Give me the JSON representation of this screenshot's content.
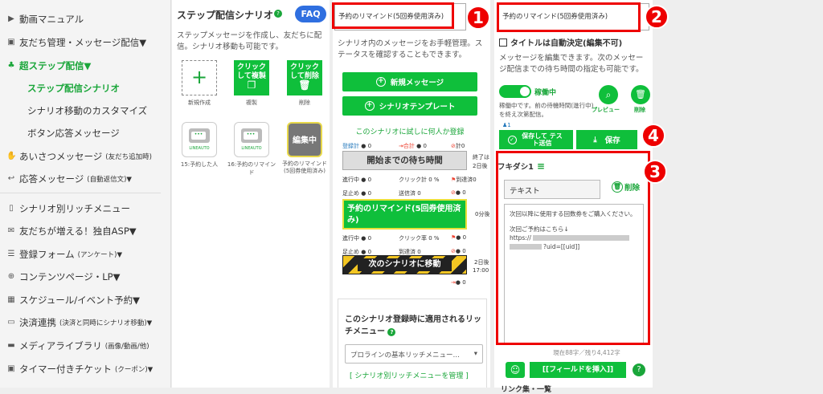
{
  "sidebar": {
    "items": [
      {
        "label": "動画マニュアル",
        "icon": "video-icon"
      },
      {
        "label": "友だち管理・メッセージ配信▼",
        "icon": "contact-icon"
      },
      {
        "label": "超ステップ配信▼",
        "icon": "hierarchy-icon"
      },
      {
        "label": "ステップ配信シナリオ"
      },
      {
        "label": "シナリオ移動のカスタマイズ"
      },
      {
        "label": "ボタン応答メッセージ"
      },
      {
        "label": "あいさつメッセージ",
        "small": "(友だち追加時)",
        "icon": "hand-icon"
      },
      {
        "label": "応答メッセージ",
        "small": "(自動返信文)▼",
        "icon": "reply-icon"
      },
      {
        "label": "シナリオ別リッチメニュー",
        "icon": "phone-icon"
      },
      {
        "label": "友だちが増える！独自ASP▼",
        "icon": "gift-icon"
      },
      {
        "label": "登録フォーム",
        "small": "(アンケート)▼",
        "icon": "list-icon"
      },
      {
        "label": "コンテンツページ・LP▼",
        "icon": "globe-icon"
      },
      {
        "label": "スケジュール/イベント予約▼",
        "icon": "calendar-icon"
      },
      {
        "label": "決済連携",
        "small": "(決済と同時にシナリオ移動)▼",
        "icon": "card-icon"
      },
      {
        "label": "メディアライブラリ",
        "small": "(画像/動画/他)",
        "icon": "folder-icon"
      },
      {
        "label": "タイマー付きチケット",
        "small": "(クーポン)▼",
        "icon": "ticket-icon"
      }
    ]
  },
  "scenario": {
    "title": "ステップ配信シナリオ",
    "faq": "FAQ",
    "desc": "ステップメッセージを作成し、友だちに配信。シナリオ移動も可能です。",
    "new_label": "新規作成",
    "copy_btn": "クリックして複製",
    "copy_label": "複製",
    "delete_btn": "クリックして削除",
    "delete_label": "削除",
    "cards": [
      {
        "label": "15:予約した人",
        "logo": "LINEAUTO"
      },
      {
        "label": "16:予約のリマインド",
        "logo": "LINEAUTO"
      },
      {
        "label": "予約のリマインド(5回券使用済み)",
        "overlay": "編集中"
      }
    ]
  },
  "middle": {
    "name_value": "予約のリマインド(5回券使用済み)",
    "desc": "シナリオ内のメッセージをお手軽管理。ステータスを確認することもできます。",
    "new_msg": "新規メッセージ",
    "template": "シナリオテンプレート",
    "test_link": "このシナリオに試しに何人か登録",
    "stats_top": {
      "reg": "登録計",
      "reg_v": "0",
      "total": "合計",
      "total_v": "0",
      "block": "計",
      "block_v": "0"
    },
    "start_label": "開始までの待ち時間",
    "end_label": "終了は",
    "end_days": "2日後",
    "row1": {
      "a": "進行中",
      "a_v": "0",
      "b": "クリック計",
      "b_v": "0 %",
      "c": "到達済",
      "c_v": "0"
    },
    "row2": {
      "a": "足止め",
      "a_v": "0",
      "b": "送信済",
      "b_v": "0",
      "c": "0"
    },
    "msg_label": "予約のリマインド(5回券使用済み)",
    "msg_after": "0分後",
    "row3": {
      "a": "進行中",
      "a_v": "0",
      "b": "クリック率",
      "b_v": "0 %",
      "c": "0"
    },
    "row4": {
      "a": "足止め",
      "a_v": "0",
      "b": "到達済",
      "b_v": "0",
      "c": "0"
    },
    "move_label": "次のシナリオに移動",
    "move_after": "2日後",
    "move_time": "17:00",
    "move_stat": "0",
    "rich_title": "このシナリオ登録時に適用されるリッチメニュー",
    "rich_select": "プロラインの基本リッチメニュー…",
    "rich_manage": "[ シナリオ別リッチメニューを管理 ]"
  },
  "editor": {
    "title_value": "予約のリマインド(5回券使用済み)",
    "auto_title": "タイトルは自動決定(編集不可)",
    "desc": "メッセージを編集できます。次のメッセージ配信までの待ち時間の指定も可能です。",
    "toggle_label": "稼働中",
    "toggle_desc": "稼働中です。前の待機時間(進行中)を終え次第配信。",
    "preview": "プレビュー",
    "delete": "削除",
    "count_icon": "1",
    "save_test": "保存して テスト送信",
    "save": "保存",
    "bubble_label": "フキダシ1",
    "type_value": "テキスト",
    "type_delete": "削除",
    "message_lines": [
      "次回以降に使用する回数券をご購入ください。",
      "",
      "次回ご予約はこちら↓",
      "https://",
      "?uid=[[uid]]"
    ],
    "counter": "現在88字／残り4,412字",
    "insert_field": "[[フィールドを挿入]]",
    "link_label": "リンク集・一覧"
  },
  "badges": [
    "1",
    "2",
    "3",
    "4"
  ],
  "colors": {
    "green": "#0fbf3b",
    "red": "#e00000",
    "accent_blue": "#2f6fe0"
  }
}
